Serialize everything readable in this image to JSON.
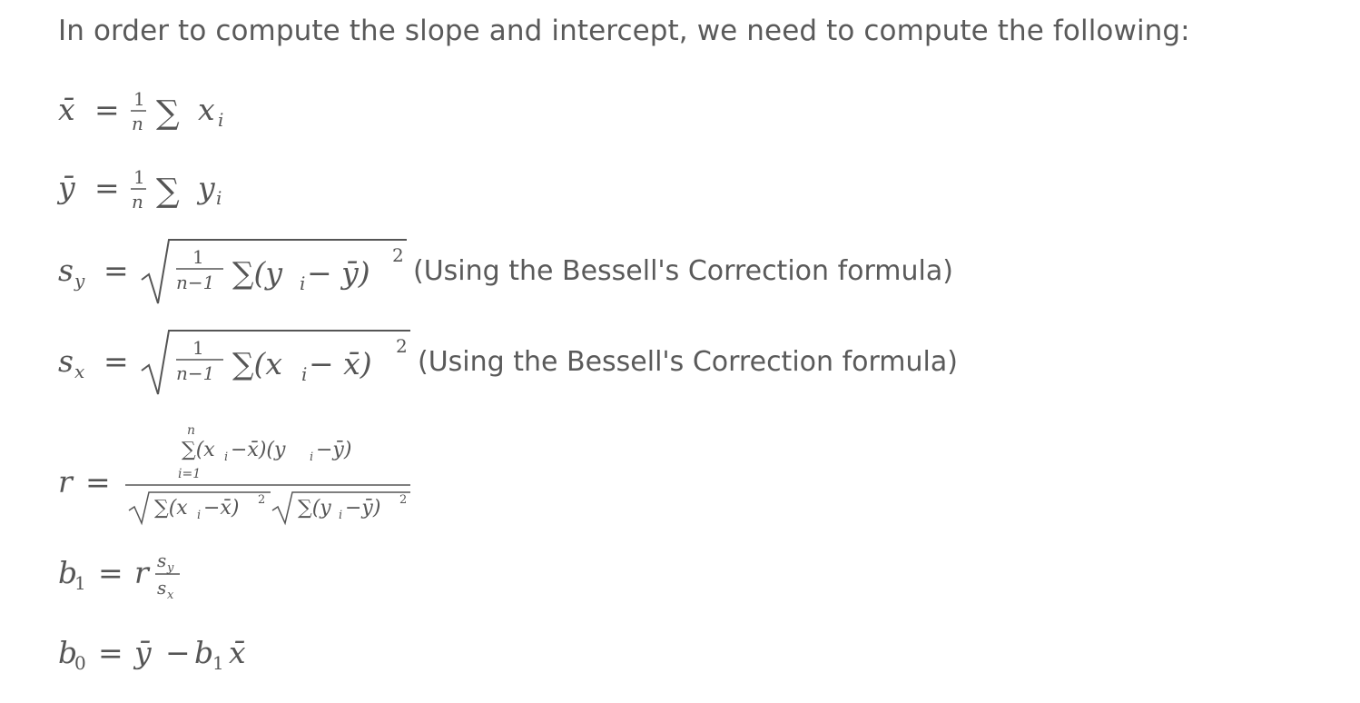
{
  "intro": "In order to compute the slope and intercept, we need to compute the following:",
  "formulas": {
    "xbar": {
      "lhs": "x̄",
      "eq": "=",
      "frac_num": "1",
      "frac_den": "n",
      "sum": "∑",
      "term": "x",
      "sub": "i"
    },
    "ybar": {
      "lhs": "ȳ",
      "eq": "=",
      "frac_num": "1",
      "frac_den": "n",
      "sum": "∑",
      "term": "y",
      "sub": "i"
    },
    "sy": {
      "lhs": "s",
      "lhs_sub": "y",
      "eq": "=",
      "frac_num": "1",
      "frac_den": "n−1",
      "body": "∑(y",
      "body_sub": "i",
      "body_rest": " − ȳ)",
      "power": "2",
      "note": "(Using the Bessell's Correction formula)"
    },
    "sx": {
      "lhs": "s",
      "lhs_sub": "x",
      "eq": "=",
      "frac_num": "1",
      "frac_den": "n−1",
      "body": "∑(x",
      "body_sub": "i",
      "body_rest": " − x̄)",
      "power": "2",
      "note": "(Using the Bessell's Correction formula)"
    },
    "r": {
      "lhs": "r",
      "eq": "=",
      "sum_top": "n",
      "sum_bottom": "i=1",
      "num_expr": "∑(x",
      "num_mid": "−x̄)(y",
      "num_end": "−ȳ)",
      "sub": "i",
      "den_left": "∑(x",
      "den_left_rest": "−x̄)",
      "den_right": "∑(y",
      "den_right_rest": "−ȳ)",
      "power": "2"
    },
    "b1": {
      "lhs": "b",
      "lhs_sub": "1",
      "eq": "=",
      "factor": "r",
      "num": "s",
      "num_sub": "y",
      "den": "s",
      "den_sub": "x"
    },
    "b0": {
      "lhs": "b",
      "lhs_sub": "0",
      "eq": "=",
      "first": "ȳ",
      "minus": "−",
      "second": "b",
      "second_sub": "1",
      "third": "x̄"
    }
  }
}
